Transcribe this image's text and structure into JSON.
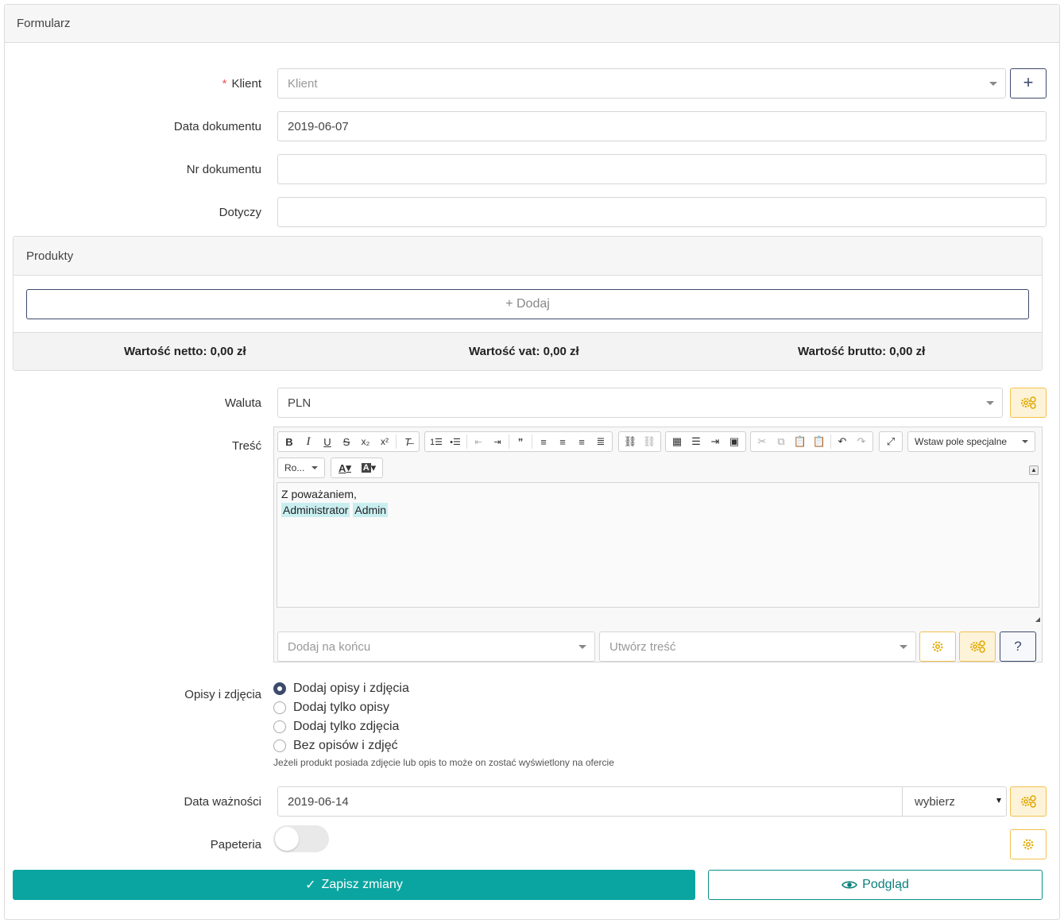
{
  "card": {
    "title": "Formularz"
  },
  "klient": {
    "label": "Klient",
    "required_mark": "*",
    "placeholder": "Klient",
    "add_button": "+"
  },
  "data_dokumentu": {
    "label": "Data dokumentu",
    "value": "2019-06-07"
  },
  "nr_dokumentu": {
    "label": "Nr dokumentu",
    "value": ""
  },
  "dotyczy": {
    "label": "Dotyczy",
    "value": ""
  },
  "produkty": {
    "title": "Produkty",
    "add_label": "+ Dodaj",
    "netto": "Wartość netto: 0,00 zł",
    "vat": "Wartość vat: 0,00 zł",
    "brutto": "Wartość brutto: 0,00 zł"
  },
  "waluta": {
    "label": "Waluta",
    "value": "PLN"
  },
  "tresc": {
    "label": "Treść",
    "toolbar": {
      "insert_special": "Wstaw pole specjalne",
      "font_select": "Ro...",
      "text_color": "A",
      "bg_color": "A"
    },
    "body_line1": "Z poważaniem,",
    "tag1": "Administrator",
    "tag2": "Admin",
    "add_at_end_placeholder": "Dodaj na końcu",
    "create_content_placeholder": "Utwórz treść",
    "help_icon_text": "?"
  },
  "opisy": {
    "label": "Opisy i zdjęcia",
    "options": [
      "Dodaj opisy i zdjęcia",
      "Dodaj tylko opisy",
      "Dodaj tylko zdjęcia",
      "Bez opisów i zdjęć"
    ],
    "selected_index": 0,
    "hint": "Jeżeli produkt posiada zdjęcie lub opis to może on zostać wyświetlony na ofercie"
  },
  "data_waznosci": {
    "label": "Data ważności",
    "value": "2019-06-14",
    "select_value": "wybierz"
  },
  "papeteria": {
    "label": "Papeteria",
    "enabled": false
  },
  "actions": {
    "save": "Zapisz zmiany",
    "preview": "Podgląd"
  },
  "colors": {
    "primary": "#0aa5a0",
    "dark": "#3d4a6b",
    "warning": "#f2c14e"
  }
}
